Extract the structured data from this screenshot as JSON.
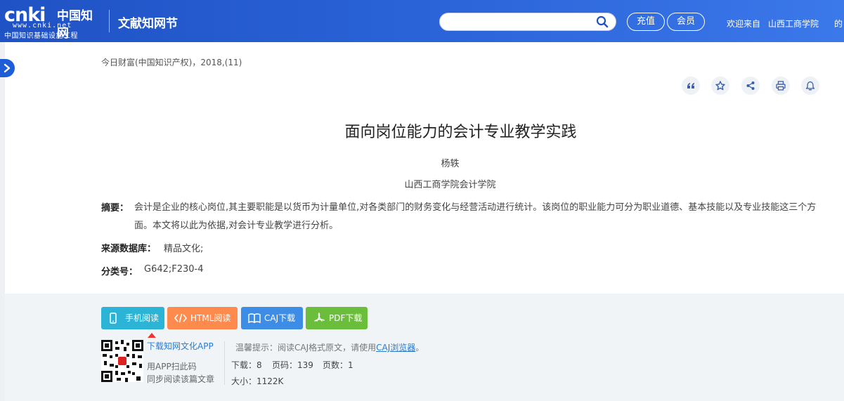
{
  "header": {
    "logo_text": "cnki",
    "logo_cn": "中国知网",
    "logo_url": "www.cnki.net",
    "logo_sub": "中国知识基础设施工程",
    "site_name": "文献知网节",
    "search_placeholder": "",
    "recharge_label": "充值",
    "member_label": "会员",
    "welcome": "欢迎来自",
    "institution": "山西工商学院",
    "extra": "的"
  },
  "article": {
    "source": "今日财富(中国知识产权)，2018,(11)",
    "title": "面向岗位能力的会计专业教学实践",
    "author": "杨轶",
    "organization": "山西工商学院会计学院",
    "abstract_label": "摘要：",
    "abstract": "会计是企业的核心岗位,其主要职能是以货币为计量单位,对各类部门的财务变化与经营活动进行统计。该岗位的职业能力可分为职业道德、基本技能以及专业技能这三个方面。本文将以此为依据,对会计专业教学进行分析。",
    "db_label": "来源数据库：",
    "db_value": "精品文化;",
    "class_label": "分类号：",
    "class_value": "G642;F230-4"
  },
  "tools": [
    "quote-icon",
    "star-icon",
    "share-icon",
    "print-icon",
    "bell-icon"
  ],
  "downloads": {
    "mobile": "手机阅读",
    "html": "HTML阅读",
    "caj": "CAJ下载",
    "pdf": "PDF下载"
  },
  "app": {
    "title": "下载知网文化APP",
    "line1": "用APP扫此码",
    "line2": "同步阅读该篇文章"
  },
  "info": {
    "tip_prefix": "温馨提示：阅读CAJ格式原文，请使用",
    "tip_link": "CAJ浏览器",
    "tip_suffix": "。",
    "downloads": "下载：8",
    "pages_code": "页码：139",
    "page_count": "页数：1",
    "size": "大小：1122K"
  },
  "colors": {
    "header": "#2a63d8",
    "mobile": "#2bb4d6",
    "html": "#ff8a4d",
    "caj": "#3d8de6",
    "pdf": "#6bbe3b"
  }
}
